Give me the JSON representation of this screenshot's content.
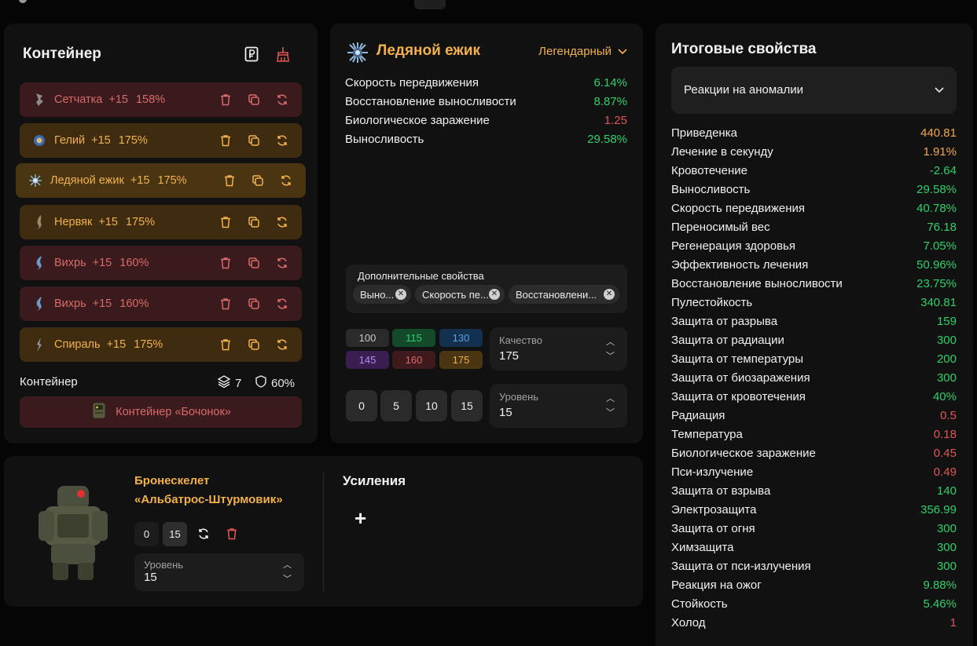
{
  "colors": {
    "accent": "#f2b14a",
    "positive": "#2fd06b",
    "negative": "#e05555",
    "panel": "#111111"
  },
  "container": {
    "title": "Контейнер",
    "items": [
      {
        "icon": "sechatka-artifact-icon",
        "name": "Сетчатка",
        "level": "+15",
        "quality": "158%",
        "tone": "red"
      },
      {
        "icon": "gelij-artifact-icon",
        "name": "Гелий",
        "level": "+15",
        "quality": "175%",
        "tone": "gold"
      },
      {
        "icon": "ice-hedgehog-artifact-icon",
        "name": "Ледяной ежик",
        "level": "+15",
        "quality": "175%",
        "tone": "gold-active"
      },
      {
        "icon": "nervyak-artifact-icon",
        "name": "Нервяк",
        "level": "+15",
        "quality": "175%",
        "tone": "gold"
      },
      {
        "icon": "vihr-artifact-icon",
        "name": "Вихрь",
        "level": "+15",
        "quality": "160%",
        "tone": "red"
      },
      {
        "icon": "vihr-artifact-icon",
        "name": "Вихрь",
        "level": "+15",
        "quality": "160%",
        "tone": "red"
      },
      {
        "icon": "spiral-artifact-icon",
        "name": "Спираль",
        "level": "+15",
        "quality": "175%",
        "tone": "gold"
      }
    ],
    "footer_label": "Контейнер",
    "slots": "7",
    "protection": "60%",
    "barrel_button": "Контейнер «Бочонок»"
  },
  "artifact": {
    "title": "Ледяной ежик",
    "rarity": "Легендарный",
    "props": [
      {
        "name": "Скорость передвижения",
        "value": "6.14%",
        "tone": "green"
      },
      {
        "name": "Восстановление выносливости",
        "value": "8.87%",
        "tone": "green"
      },
      {
        "name": "Биологическое заражение",
        "value": "1.25",
        "tone": "red"
      },
      {
        "name": "Выносливость",
        "value": "29.58%",
        "tone": "green"
      }
    ],
    "extra_label": "Дополнительные свойства",
    "chips": [
      "Выно...",
      "Скорость пе...",
      "Восстановлени..."
    ],
    "quality_buttons": [
      "100",
      "115",
      "130",
      "145",
      "160",
      "175"
    ],
    "quality_label": "Качество",
    "quality_value": "175",
    "level_buttons": [
      "0",
      "5",
      "10",
      "15"
    ],
    "level_label": "Уровень",
    "level_value": "15"
  },
  "armor": {
    "name_line1": "Бронескелет",
    "name_line2": "«Альбатрос-Штурмовик»",
    "levels": [
      "0",
      "15"
    ],
    "level_label": "Уровень",
    "level_value": "15",
    "boosts_title": "Усиления",
    "add_label": "+"
  },
  "totals": {
    "title": "Итоговые свойства",
    "filter": "Реакции на аномалии",
    "rows": [
      {
        "name": "Приведенка",
        "value": "440.81",
        "tone": "orange"
      },
      {
        "name": "Лечение в секунду",
        "value": "1.91%",
        "tone": "orange"
      },
      {
        "name": "Кровотечение",
        "value": "-2.64",
        "tone": "green"
      },
      {
        "name": "Выносливость",
        "value": "29.58%",
        "tone": "green"
      },
      {
        "name": "Скорость передвижения",
        "value": "40.78%",
        "tone": "green"
      },
      {
        "name": "Переносимый вес",
        "value": "76.18",
        "tone": "green"
      },
      {
        "name": "Регенерация здоровья",
        "value": "7.05%",
        "tone": "green"
      },
      {
        "name": "Эффективность лечения",
        "value": "50.96%",
        "tone": "green"
      },
      {
        "name": "Восстановление выносливости",
        "value": "23.75%",
        "tone": "green"
      },
      {
        "name": "Пулестойкость",
        "value": "340.81",
        "tone": "green"
      },
      {
        "name": "Защита от разрыва",
        "value": "159",
        "tone": "green"
      },
      {
        "name": "Защита от радиации",
        "value": "300",
        "tone": "green"
      },
      {
        "name": "Защита от температуры",
        "value": "200",
        "tone": "green"
      },
      {
        "name": "Защита от биозаражения",
        "value": "300",
        "tone": "green"
      },
      {
        "name": "Защита от кровотечения",
        "value": "40%",
        "tone": "green"
      },
      {
        "name": "Радиация",
        "value": "0.5",
        "tone": "red"
      },
      {
        "name": "Температура",
        "value": "0.18",
        "tone": "red"
      },
      {
        "name": "Биологическое заражение",
        "value": "0.45",
        "tone": "red"
      },
      {
        "name": "Пси-излучение",
        "value": "0.49",
        "tone": "red"
      },
      {
        "name": "Защита от взрыва",
        "value": "140",
        "tone": "green"
      },
      {
        "name": "Электрозащита",
        "value": "356.99",
        "tone": "green"
      },
      {
        "name": "Защита от огня",
        "value": "300",
        "tone": "green"
      },
      {
        "name": "Химзащита",
        "value": "300",
        "tone": "green"
      },
      {
        "name": "Защита от пси-излучения",
        "value": "300",
        "tone": "green"
      },
      {
        "name": "Реакция на ожог",
        "value": "9.88%",
        "tone": "green"
      },
      {
        "name": "Стойкость",
        "value": "5.46%",
        "tone": "green"
      },
      {
        "name": "Холод",
        "value": "1",
        "tone": "red"
      }
    ]
  }
}
